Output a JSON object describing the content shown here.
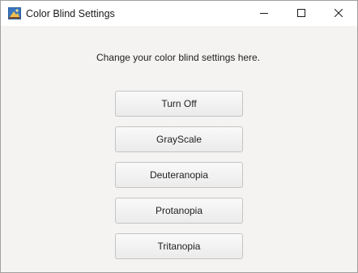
{
  "window": {
    "title": "Color Blind Settings"
  },
  "main": {
    "prompt": "Change your color blind settings here.",
    "buttons": [
      {
        "label": "Turn Off"
      },
      {
        "label": "GrayScale"
      },
      {
        "label": "Deuteranopia"
      },
      {
        "label": "Protanopia"
      },
      {
        "label": "Tritanopia"
      }
    ]
  }
}
